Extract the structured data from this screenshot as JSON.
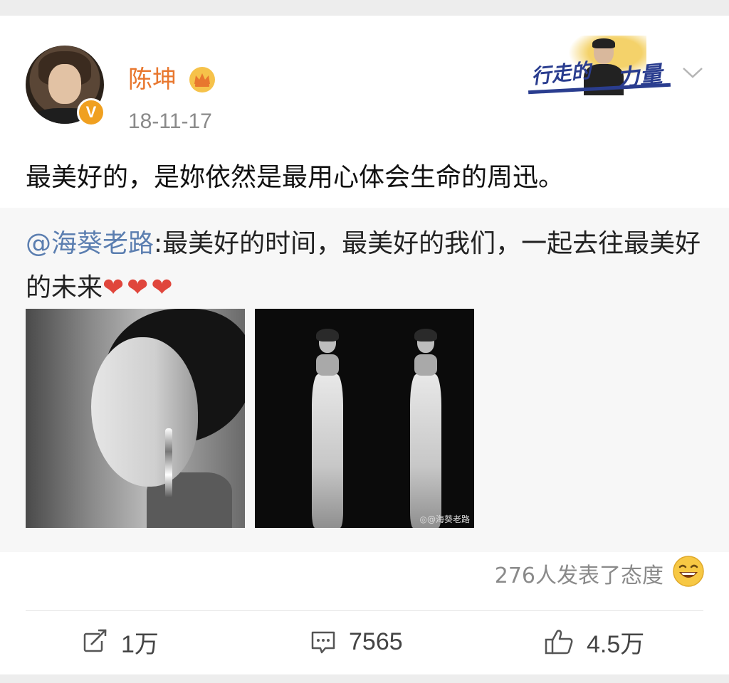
{
  "post": {
    "username": "陈坤",
    "timestamp": "18-11-17",
    "verified_badge": "V",
    "text": "最美好的，是妳依然是最用心体会生命的周迅。",
    "banner": {
      "part1": "行走的",
      "part2": "力量"
    }
  },
  "repost": {
    "mention": "@海葵老路",
    "text": ":最美好的时间，最美好的我们，一起去往最美好的未来",
    "hearts": "❤❤❤",
    "watermark": "◎@海葵老路"
  },
  "reactions": {
    "text": "276人发表了态度"
  },
  "actions": {
    "share_count": "1万",
    "comment_count": "7565",
    "like_count": "4.5万"
  },
  "colors": {
    "username": "#e8772e",
    "mention": "#5b7eb0",
    "verified": "#f0a020"
  }
}
